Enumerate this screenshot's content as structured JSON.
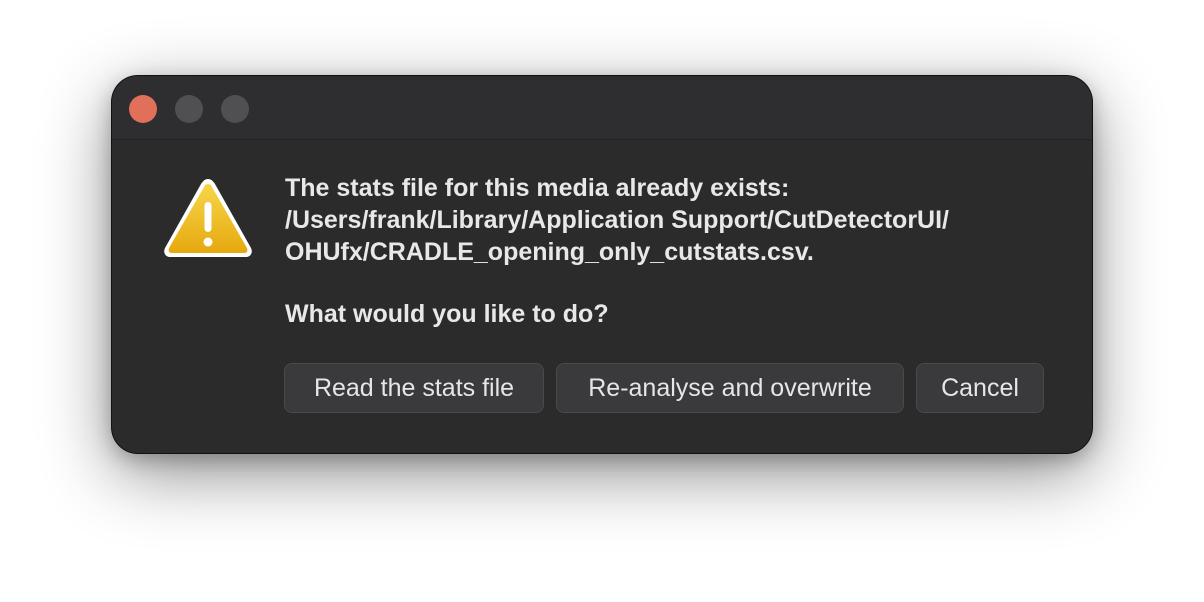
{
  "dialog": {
    "message_lines": [
      "The stats file for this media already exists:",
      "/Users/frank/Library/Application Support/CutDetectorUI/",
      "OHUfx/CRADLE_opening_only_cutstats.csv."
    ],
    "question": "What would you like to do?",
    "icon": "warning-icon"
  },
  "buttons": {
    "read": "Read the stats file",
    "reanalyse": "Re-analyse and overwrite",
    "cancel": "Cancel"
  },
  "colors": {
    "window_bg": "#2b2b2c",
    "close_button": "#e0705a",
    "warning_yellow": "#f0c419"
  }
}
